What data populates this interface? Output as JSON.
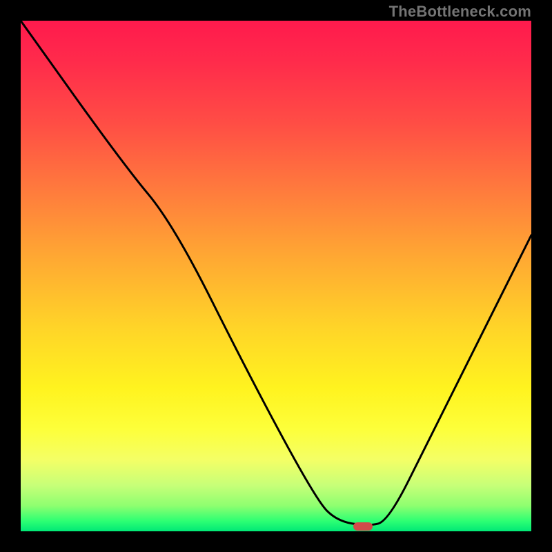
{
  "watermark": "TheBottleneck.com",
  "chart_data": {
    "type": "line",
    "title": "",
    "xlabel": "",
    "ylabel": "",
    "xlim": [
      0,
      100
    ],
    "ylim": [
      0,
      100
    ],
    "grid": false,
    "legend": false,
    "series": [
      {
        "name": "curve",
        "x": [
          0,
          20,
          30,
          45,
          58,
          62,
          68,
          72,
          80,
          100
        ],
        "values": [
          100,
          72,
          60,
          30,
          6,
          2,
          1,
          2,
          18,
          58
        ]
      }
    ],
    "marker": {
      "x": 67,
      "y": 1
    },
    "background_gradient": {
      "top": "#ff1a4d",
      "mid": "#fff31f",
      "bottom": "#00e876"
    },
    "line_color": "#000000",
    "marker_color": "#d24a4a"
  }
}
